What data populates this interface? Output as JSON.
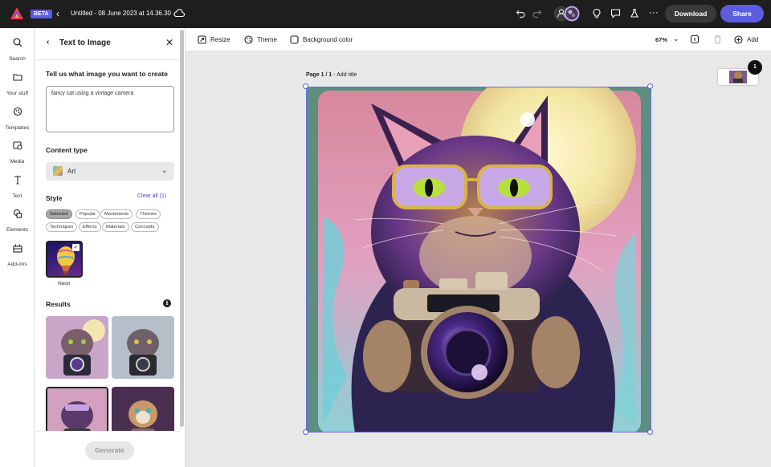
{
  "header": {
    "badge": "BETA",
    "doc_title": "Untitled - 08 June 2023 at 14.36.30",
    "download_label": "Download",
    "share_label": "Share"
  },
  "rail": [
    {
      "label": "Search",
      "icon": "search-icon"
    },
    {
      "label": "Your stuff",
      "icon": "folder-icon"
    },
    {
      "label": "Templates",
      "icon": "templates-icon"
    },
    {
      "label": "Media",
      "icon": "media-icon"
    },
    {
      "label": "Text",
      "icon": "text-icon"
    },
    {
      "label": "Elements",
      "icon": "elements-icon"
    },
    {
      "label": "Add-ons",
      "icon": "addons-icon"
    }
  ],
  "panel": {
    "title": "Text to Image",
    "prompt_label": "Tell us what image you want to create",
    "prompt_value": "fancy cat using a vintage camera",
    "content_type_label": "Content type",
    "content_type_value": "Art",
    "style_label": "Style",
    "clear_all": "Clear all (1)",
    "chips": [
      "Selected",
      "Popular",
      "Movements",
      "Themes",
      "Techniques",
      "Effects",
      "Materials",
      "Concepts"
    ],
    "selected_style": "Neon",
    "results_label": "Results",
    "generate_label": "Generate"
  },
  "toolbar": {
    "resize": "Resize",
    "theme": "Theme",
    "background_color": "Background color",
    "zoom": "67%",
    "add": "Add"
  },
  "canvas": {
    "page_label": "Page 1 / 1",
    "add_title": "Add title",
    "page_count": "1"
  },
  "colors": {
    "accent": "#5c5ce0",
    "topbar": "#1e1e1e"
  }
}
